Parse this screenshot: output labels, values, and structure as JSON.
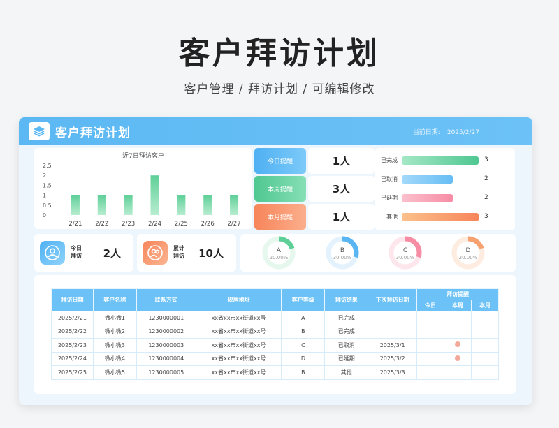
{
  "hero": {
    "title": "客户拜访计划",
    "subtitle": "客户管理 / 拜访计划 /  可编辑修改"
  },
  "header": {
    "title": "客户拜访计划",
    "date_label": "当前日期:",
    "date_value": "2025/2/27",
    "logo_icon": "stack-layers-icon"
  },
  "chart_data": {
    "type": "bar",
    "title": "近7日拜访客户",
    "categories": [
      "2/21",
      "2/22",
      "2/23",
      "2/24",
      "2/25",
      "2/26",
      "2/27"
    ],
    "values": [
      1,
      1,
      1,
      2,
      1,
      1,
      1
    ],
    "ylim": [
      0,
      2.5
    ],
    "yticks": [
      "2.5",
      "2",
      "1.5",
      "1",
      "0.5",
      "0"
    ],
    "bar_color_top": "#5fcf98",
    "bar_color_bottom": "#b8edd0"
  },
  "reminders": [
    {
      "label": "今日提醒",
      "value": "1人",
      "color_a": "#4fb0f2",
      "color_b": "#7ccaf9"
    },
    {
      "label": "本周提醒",
      "value": "3人",
      "color_a": "#4fc791",
      "color_b": "#86dfb5"
    },
    {
      "label": "本月提醒",
      "value": "1人",
      "color_a": "#f7855a",
      "color_b": "#fbae8c"
    }
  ],
  "status": [
    {
      "label": "已完成",
      "value": 3,
      "color_a": "#4fc791",
      "color_b": "#a5e8c6"
    },
    {
      "label": "已取消",
      "value": 2,
      "color_a": "#66bdf5",
      "color_b": "#a3d9fb"
    },
    {
      "label": "已延期",
      "value": 2,
      "color_a": "#f78ca5",
      "color_b": "#fbc0cd"
    },
    {
      "label": "其他",
      "value": 3,
      "color_a": "#f7855a",
      "color_b": "#fbc18c"
    }
  ],
  "status_max": 3,
  "stats": [
    {
      "label": "今日拜访",
      "value": "2人",
      "icon": "user-icon",
      "color_a": "#4fb0f2",
      "color_b": "#8fd3fb"
    },
    {
      "label": "累计拜访",
      "value": "10人",
      "icon": "users-icon",
      "color_a": "#f7855a",
      "color_b": "#fbb491"
    }
  ],
  "levels": [
    {
      "letter": "A",
      "pct": "20.00%",
      "fraction": 0.2,
      "color": "#5fcf98",
      "track": "#e6f7ee"
    },
    {
      "letter": "B",
      "pct": "30.00%",
      "fraction": 0.3,
      "color": "#5ab5f3",
      "track": "#e3f2fc"
    },
    {
      "letter": "C",
      "pct": "30.00%",
      "fraction": 0.3,
      "color": "#f78ca5",
      "track": "#fde6ec"
    },
    {
      "letter": "D",
      "pct": "20.00%",
      "fraction": 0.2,
      "color": "#f7a070",
      "track": "#fdecdf"
    }
  ],
  "table": {
    "headers": [
      "拜访日期",
      "客户名称",
      "联系方式",
      "现居地址",
      "客户等级",
      "拜访结果",
      "下次拜访日期",
      "拜访提醒"
    ],
    "sub_headers": [
      "今日",
      "本周",
      "本月"
    ],
    "rows": [
      [
        "2025/2/21",
        "微小微1",
        "1230000001",
        "xx省xx市xx街道xx号",
        "A",
        "已完成",
        "",
        "",
        "",
        ""
      ],
      [
        "2025/2/22",
        "微小微2",
        "1230000002",
        "xx省xx市xx街道xx号",
        "B",
        "已完成",
        "",
        "",
        "",
        ""
      ],
      [
        "2025/2/23",
        "微小微3",
        "1230000003",
        "xx省xx市xx街道xx号",
        "C",
        "已取消",
        "2025/3/1",
        "",
        "●",
        ""
      ],
      [
        "2025/2/24",
        "微小微4",
        "1230000004",
        "xx省xx市xx街道xx号",
        "D",
        "已延期",
        "2025/3/2",
        "",
        "●",
        ""
      ],
      [
        "2025/2/25",
        "微小微5",
        "1230000005",
        "xx省xx市xx街道xx号",
        "B",
        "其他",
        "2025/3/3",
        "",
        "",
        ""
      ]
    ]
  }
}
